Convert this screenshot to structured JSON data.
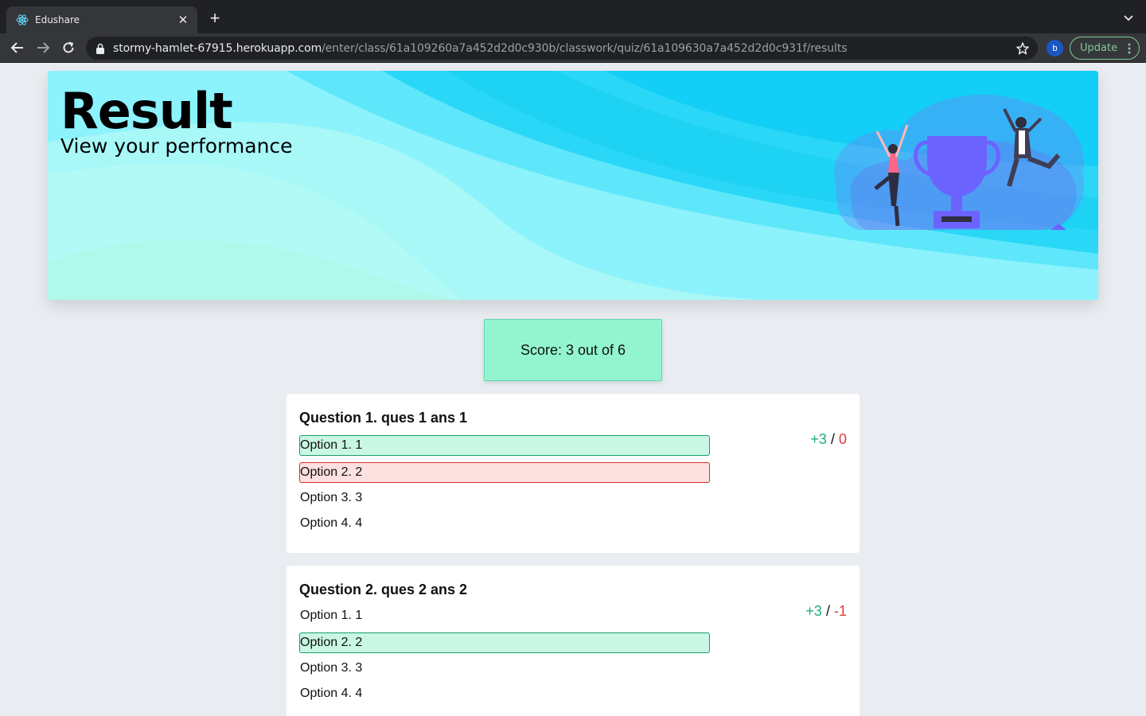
{
  "browser": {
    "tab_title": "Edushare",
    "url_host": "stormy-hamlet-67915.herokuapp.com",
    "url_path": "/enter/class/61a109260a7a452d2d0c930b/classwork/quiz/61a109630a7a452d2d0c931f/results",
    "avatar_letter": "b",
    "update_label": "Update"
  },
  "banner": {
    "title": "Result",
    "subtitle": "View your performance"
  },
  "score": {
    "text": "Score: 3 out of 6"
  },
  "questions": [
    {
      "title": "Question 1. ques 1 ans 1",
      "marks_positive": "+3",
      "marks_separator": "/",
      "marks_negative": "0",
      "options": [
        {
          "label": "Option 1. 1",
          "state": "correct"
        },
        {
          "label": "Option 2. 2",
          "state": "wrong"
        },
        {
          "label": "Option 3. 3",
          "state": "none"
        },
        {
          "label": "Option 4. 4",
          "state": "none"
        }
      ]
    },
    {
      "title": "Question 2. ques 2 ans 2",
      "marks_positive": "+3",
      "marks_separator": "/",
      "marks_negative": "-1",
      "options": [
        {
          "label": "Option 1. 1",
          "state": "none"
        },
        {
          "label": "Option 2. 2",
          "state": "correct"
        },
        {
          "label": "Option 3. 3",
          "state": "none"
        },
        {
          "label": "Option 4. 4",
          "state": "none"
        }
      ]
    }
  ],
  "colors": {
    "correct_bg": "#c9f7e4",
    "wrong_bg": "#fde0e0",
    "score_bg": "#93f5d0",
    "positive": "#1fae73",
    "negative": "#e53935"
  }
}
